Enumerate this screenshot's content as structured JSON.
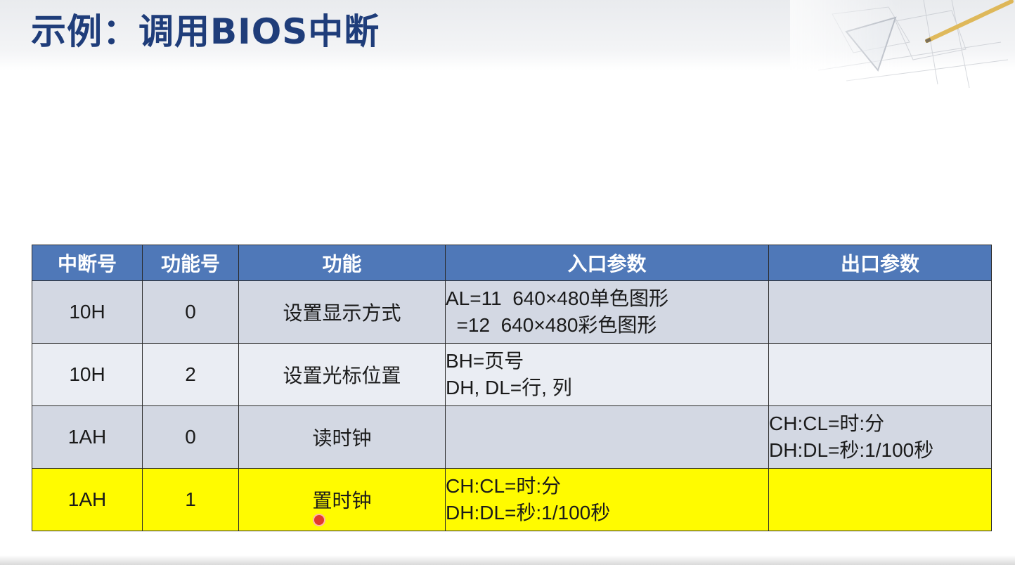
{
  "slide": {
    "title": "示例：调用BIOS中断"
  },
  "table": {
    "headers": [
      "中断号",
      "功能号",
      "功能",
      "入口参数",
      "出口参数"
    ],
    "rows": [
      {
        "interrupt": "10H",
        "function_no": "0",
        "function": "设置显示方式",
        "entry_params": [
          "AL=11  640×480单色图形",
          "  =12  640×480彩色图形"
        ],
        "exit_params": []
      },
      {
        "interrupt": "10H",
        "function_no": "2",
        "function": "设置光标位置",
        "entry_params": [
          "BH=页号",
          "DH, DL=行, 列"
        ],
        "exit_params": []
      },
      {
        "interrupt": "1AH",
        "function_no": "0",
        "function": "读时钟",
        "entry_params": [],
        "exit_params": [
          "CH:CL=时:分",
          "DH:DL=秒:1/100秒"
        ]
      },
      {
        "interrupt": "1AH",
        "function_no": "1",
        "function": "置时钟",
        "entry_params": [
          "CH:CL=时:分",
          "DH:DL=秒:1/100秒"
        ],
        "exit_params": []
      }
    ]
  },
  "colors": {
    "title": "#1f3d7a",
    "header_bg": "#4f78b8",
    "row_odd": "#d3d8e3",
    "row_even": "#eaedf3",
    "highlight": "#fffb00"
  },
  "icons": {
    "decoration": "drafting-tools-decoration",
    "cursor": "mouse-cursor-pointer"
  }
}
